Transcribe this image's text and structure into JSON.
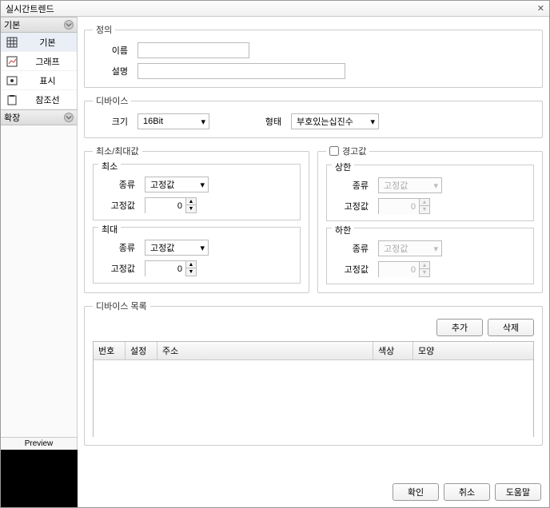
{
  "window": {
    "title": "실시간트렌드",
    "close_symbol": "✕"
  },
  "sidebar": {
    "groups": {
      "basic": {
        "label": "기본"
      },
      "expand": {
        "label": "확장"
      }
    },
    "items": [
      {
        "label": "기본"
      },
      {
        "label": "그래프"
      },
      {
        "label": "표시"
      },
      {
        "label": "참조선"
      }
    ],
    "preview_label": "Preview"
  },
  "definition": {
    "legend": "정의",
    "name_label": "이름",
    "name_value": "",
    "desc_label": "설명",
    "desc_value": ""
  },
  "device": {
    "legend": "디바이스",
    "size_label": "크기",
    "size_value": "16Bit",
    "type_label": "형태",
    "type_value": "부호있는십진수"
  },
  "minmax": {
    "legend": "최소/최대값",
    "min_legend": "최소",
    "max_legend": "최대",
    "kind_label": "종류",
    "kind_value": "고정값",
    "fixed_label": "고정값",
    "fixed_value": "0"
  },
  "alert": {
    "legend": "경고값",
    "checked": false,
    "upper_legend": "상한",
    "lower_legend": "하한",
    "kind_label": "종류",
    "kind_value": "고정값",
    "fixed_label": "고정값",
    "fixed_value": "0"
  },
  "device_list": {
    "legend": "디바이스 목록",
    "add_label": "추가",
    "delete_label": "삭제",
    "columns": {
      "no": "번호",
      "setting": "설정",
      "address": "주소",
      "color": "색상",
      "shape": "모양"
    }
  },
  "buttons": {
    "ok": "확인",
    "cancel": "취소",
    "help": "도움말"
  }
}
